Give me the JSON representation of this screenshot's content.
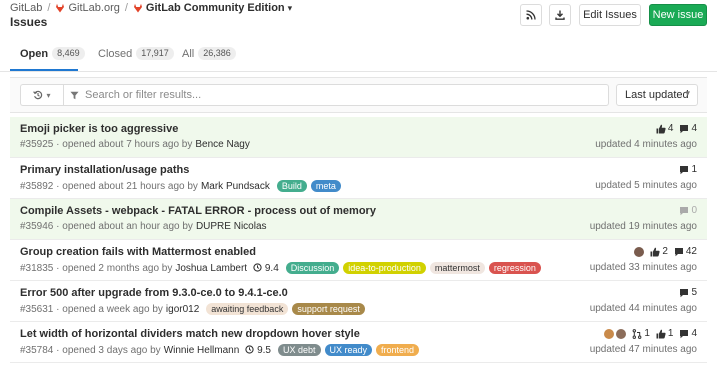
{
  "breadcrumb": {
    "group": "GitLab",
    "subgroup": "GitLab.org",
    "project": "GitLab Community Edition"
  },
  "page_title": "Issues",
  "header_buttons": {
    "edit": "Edit Issues",
    "new": "New issue"
  },
  "tabs": [
    {
      "label": "Open",
      "count": "8,469"
    },
    {
      "label": "Closed",
      "count": "17,917"
    },
    {
      "label": "All",
      "count": "26,386"
    }
  ],
  "filter": {
    "placeholder": "Search or filter results...",
    "sort": "Last updated"
  },
  "colors": {
    "brand_orange": "#e24329",
    "primary_green": "#1aaa55",
    "active_tab_blue": "#1f78d1",
    "highlight_row": "#f0f9ec"
  },
  "issues": [
    {
      "title": "Emoji picker is too aggressive",
      "number": "#35925",
      "opened": "· opened about 7 hours ago by",
      "author": "Bence Nagy",
      "milestone": "",
      "labels": [],
      "thumbs_up": "4",
      "comments": "4",
      "updated": "updated 4 minutes ago"
    },
    {
      "title": "Primary installation/usage paths",
      "number": "#35892",
      "opened": "· opened about 21 hours ago by",
      "author": "Mark Pundsack",
      "milestone": "",
      "labels": [
        {
          "text": "Build",
          "bg": "#44ad8e",
          "fg": "#ffffff"
        },
        {
          "text": "meta",
          "bg": "#428bca",
          "fg": "#ffffff"
        }
      ],
      "comments": "1",
      "updated": "updated 5 minutes ago"
    },
    {
      "title": "Compile Assets - webpack - FATAL ERROR - process out of memory",
      "number": "#35946",
      "opened": "· opened about an hour ago by",
      "author": "DUPRE Nicolas",
      "milestone": "",
      "labels": [],
      "comments": "0",
      "updated": "updated 19 minutes ago"
    },
    {
      "title": "Group creation fails with Mattermost enabled",
      "number": "#31835",
      "opened": "· opened 2 months ago by",
      "author": "Joshua Lambert",
      "milestone": "9.4",
      "labels": [
        {
          "text": "Discussion",
          "bg": "#44ad8e",
          "fg": "#ffffff"
        },
        {
          "text": "idea-to-production",
          "bg": "#d1d100",
          "fg": "#ffffff"
        },
        {
          "text": "mattermost",
          "bg": "#f0e6e0",
          "fg": "#333333"
        },
        {
          "text": "regression",
          "bg": "#d9534f",
          "fg": "#ffffff"
        }
      ],
      "thumbs_up": "2",
      "comments": "42",
      "updated": "updated 33 minutes ago"
    },
    {
      "title": "Error 500 after upgrade from 9.3.0-ce.0 to 9.4.1-ce.0",
      "number": "#35631",
      "opened": "· opened a week ago by",
      "author": "igor012",
      "milestone": "",
      "labels": [
        {
          "text": "awaiting feedback",
          "bg": "#f2e3d5",
          "fg": "#333333"
        },
        {
          "text": "support request",
          "bg": "#a8894a",
          "fg": "#ffffff"
        }
      ],
      "comments": "5",
      "updated": "updated 44 minutes ago"
    },
    {
      "title": "Let width of horizontal dividers match new dropdown hover style",
      "number": "#35784",
      "opened": "· opened 3 days ago by",
      "author": "Winnie Hellmann",
      "milestone": "9.5",
      "labels": [
        {
          "text": "UX debt",
          "bg": "#7f8c8d",
          "fg": "#ffffff"
        },
        {
          "text": "UX ready",
          "bg": "#428bca",
          "fg": "#ffffff"
        },
        {
          "text": "frontend",
          "bg": "#f0ad4e",
          "fg": "#ffffff"
        }
      ],
      "merge_requests": "1",
      "thumbs_up": "1",
      "comments": "4",
      "updated": "updated 47 minutes ago"
    }
  ]
}
